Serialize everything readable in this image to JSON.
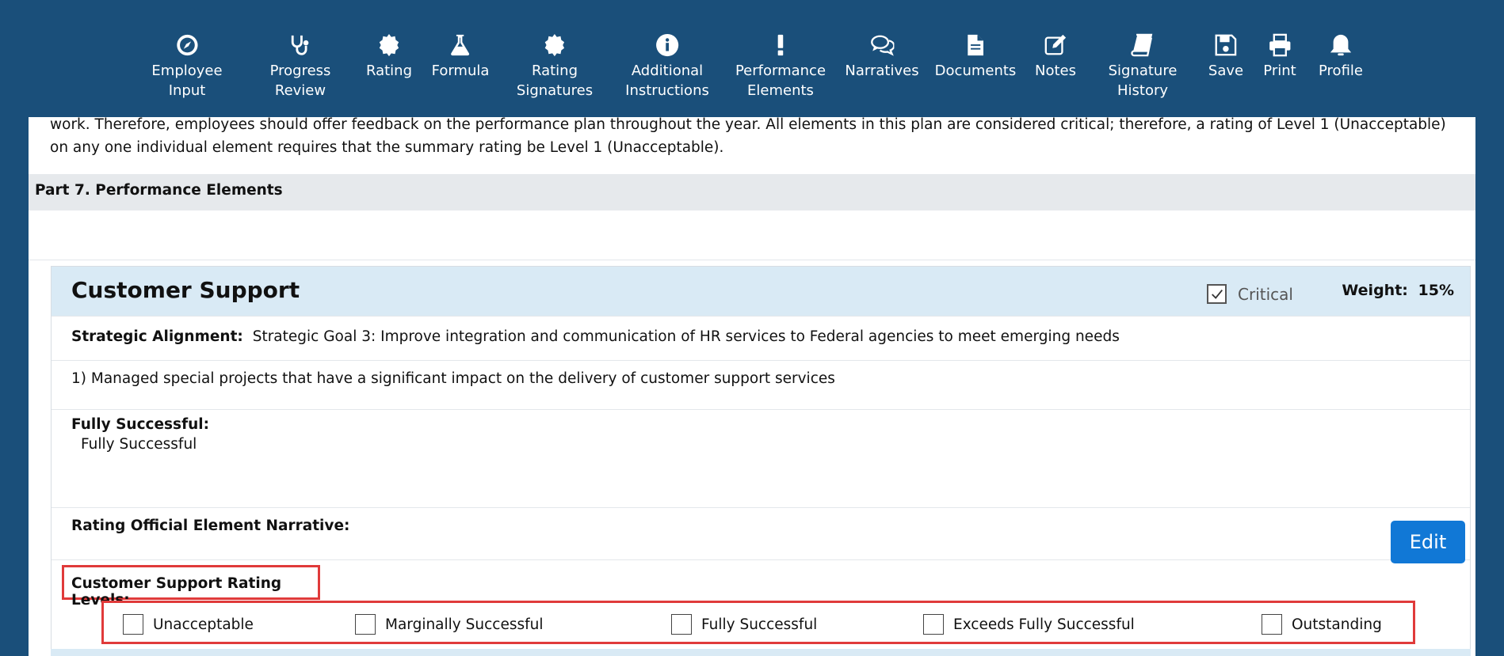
{
  "toolbar": {
    "items": [
      {
        "label": "Employee\nInput",
        "icon": "compass-icon"
      },
      {
        "label": "Progress\nReview",
        "icon": "stethoscope-icon"
      },
      {
        "label": "Rating",
        "icon": "certificate-icon"
      },
      {
        "label": "Formula",
        "icon": "flask-icon"
      },
      {
        "label": "Rating\nSignatures",
        "icon": "certificate-icon"
      },
      {
        "label": "Additional\nInstructions",
        "icon": "info-circle-icon"
      },
      {
        "label": "Performance\nElements",
        "icon": "exclamation-icon"
      },
      {
        "label": "Narratives",
        "icon": "comments-icon"
      },
      {
        "label": "Documents",
        "icon": "file-icon"
      },
      {
        "label": "Notes",
        "icon": "edit-icon"
      },
      {
        "label": "Signature\nHistory",
        "icon": "book-icon"
      },
      {
        "label": "Save",
        "icon": "floppy-disk-icon"
      },
      {
        "label": "Print",
        "icon": "printer-icon"
      },
      {
        "label": "Profile",
        "icon": "bell-icon"
      }
    ]
  },
  "intro": {
    "text": "work. Therefore, employees should offer feedback on the performance plan throughout the year. All elements in this plan are considered critical; therefore, a rating of Level 1 (Unacceptable) on any one individual element requires that the summary rating be Level 1 (Unacceptable)."
  },
  "part": {
    "title": "Part 7. Performance Elements"
  },
  "element": {
    "title": "Customer Support",
    "critical_label": "Critical",
    "critical_checked": true,
    "weight_label": "Weight:",
    "weight_value": "15%",
    "strategic_label": "Strategic Alignment:",
    "strategic_value": "Strategic Goal 3: Improve integration and communication of HR services to Federal agencies to meet emerging needs",
    "measure": "1) Managed special projects that have a significant impact on the delivery of customer support services",
    "standard_label": "Fully Successful:",
    "standard_value": "Fully Successful",
    "narrative_label": "Rating Official Element Narrative:",
    "edit_label": "Edit",
    "levels_title": "Customer Support Rating Levels:",
    "levels": [
      "Unacceptable",
      "Marginally Successful",
      "Fully Successful",
      "Exceeds Fully Successful",
      "Outstanding"
    ]
  },
  "colors": {
    "toolbar_bg": "#1a4f7a",
    "header_bg": "#d9eaf5",
    "edit_button": "#1178d6",
    "highlight": "#e03a3a"
  }
}
